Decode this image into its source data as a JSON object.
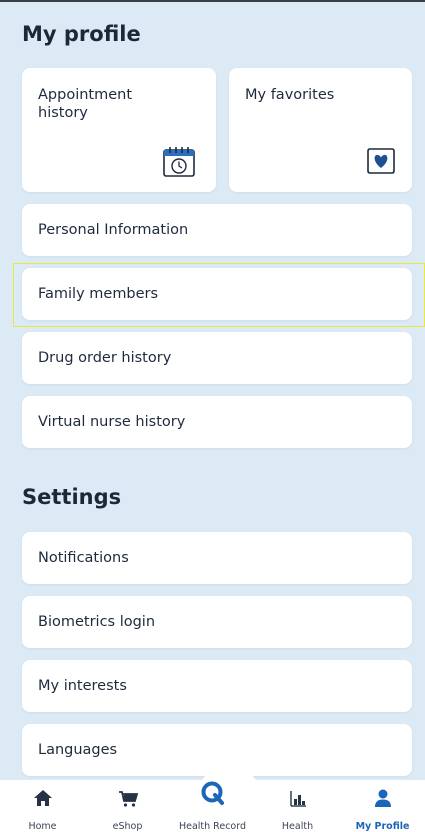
{
  "profile": {
    "title": "My profile",
    "tiles": [
      {
        "label": "Appointment history",
        "icon": "calendar-clock-icon"
      },
      {
        "label": "My favorites",
        "icon": "heart-card-icon"
      }
    ],
    "items": [
      {
        "label": "Personal Information"
      },
      {
        "label": "Family members"
      },
      {
        "label": "Drug order history"
      },
      {
        "label": "Virtual nurse history"
      }
    ]
  },
  "settings": {
    "title": "Settings",
    "items": [
      {
        "label": "Notifications"
      },
      {
        "label": "Biometrics login"
      },
      {
        "label": "My interests"
      },
      {
        "label": "Languages"
      }
    ]
  },
  "tabbar": {
    "tabs": [
      {
        "label": "Home",
        "icon": "home-icon"
      },
      {
        "label": "eShop",
        "icon": "cart-icon"
      },
      {
        "label": "Health Record",
        "icon": "q-logo-icon"
      },
      {
        "label": "Health",
        "icon": "bar-chart-icon"
      },
      {
        "label": "My Profile",
        "icon": "person-icon",
        "active": true
      }
    ]
  },
  "colors": {
    "background": "#dceaf5",
    "accent": "#1b66b8",
    "highlight": "#e9e93a"
  }
}
